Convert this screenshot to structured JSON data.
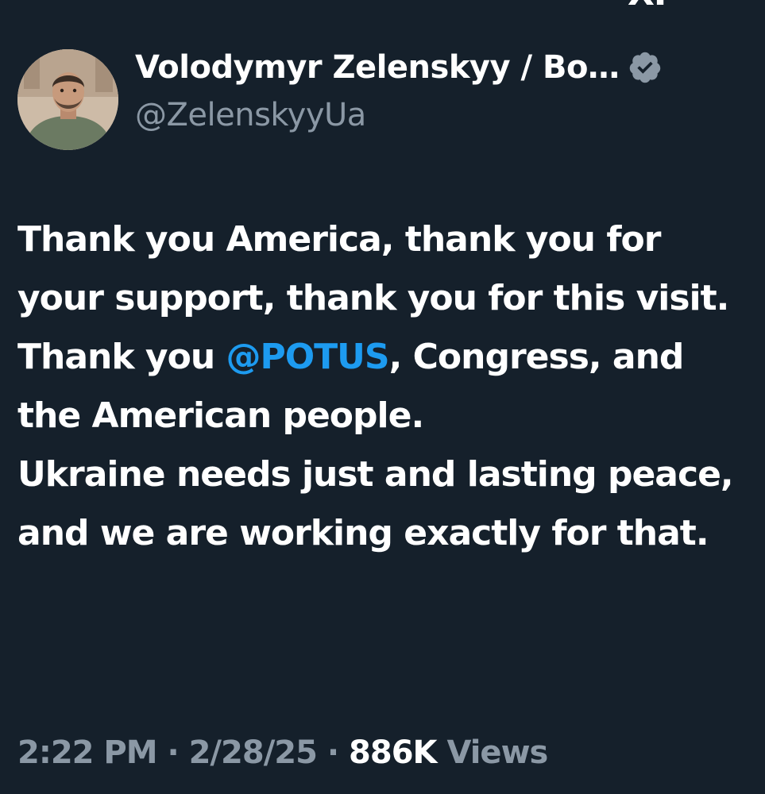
{
  "header": {
    "clipped_top_text": "XP"
  },
  "tweet": {
    "author": {
      "display_name": "Volodymyr Zelenskyy / Bo…",
      "handle": "@ZelenskyyUa",
      "verified_icon": "verified-badge-icon",
      "avatar_icon": "profile-photo"
    },
    "text": {
      "part1": "Thank you America, thank you for your support, thank you for this visit. Thank you ",
      "mention": "@POTUS",
      "part2": ", Congress, and the American people.",
      "part3": "Ukraine needs just and lasting peace, and we are working exactly for that."
    },
    "meta": {
      "time": "2:22 PM",
      "separator": " · ",
      "date": "2/28/25",
      "views_count": "886K",
      "views_label": "Views"
    }
  },
  "colors": {
    "background": "#15202b",
    "text_primary": "#ffffff",
    "text_secondary": "#8b98a5",
    "link": "#1d9bf0",
    "verified_badge": "#8b98a5"
  }
}
